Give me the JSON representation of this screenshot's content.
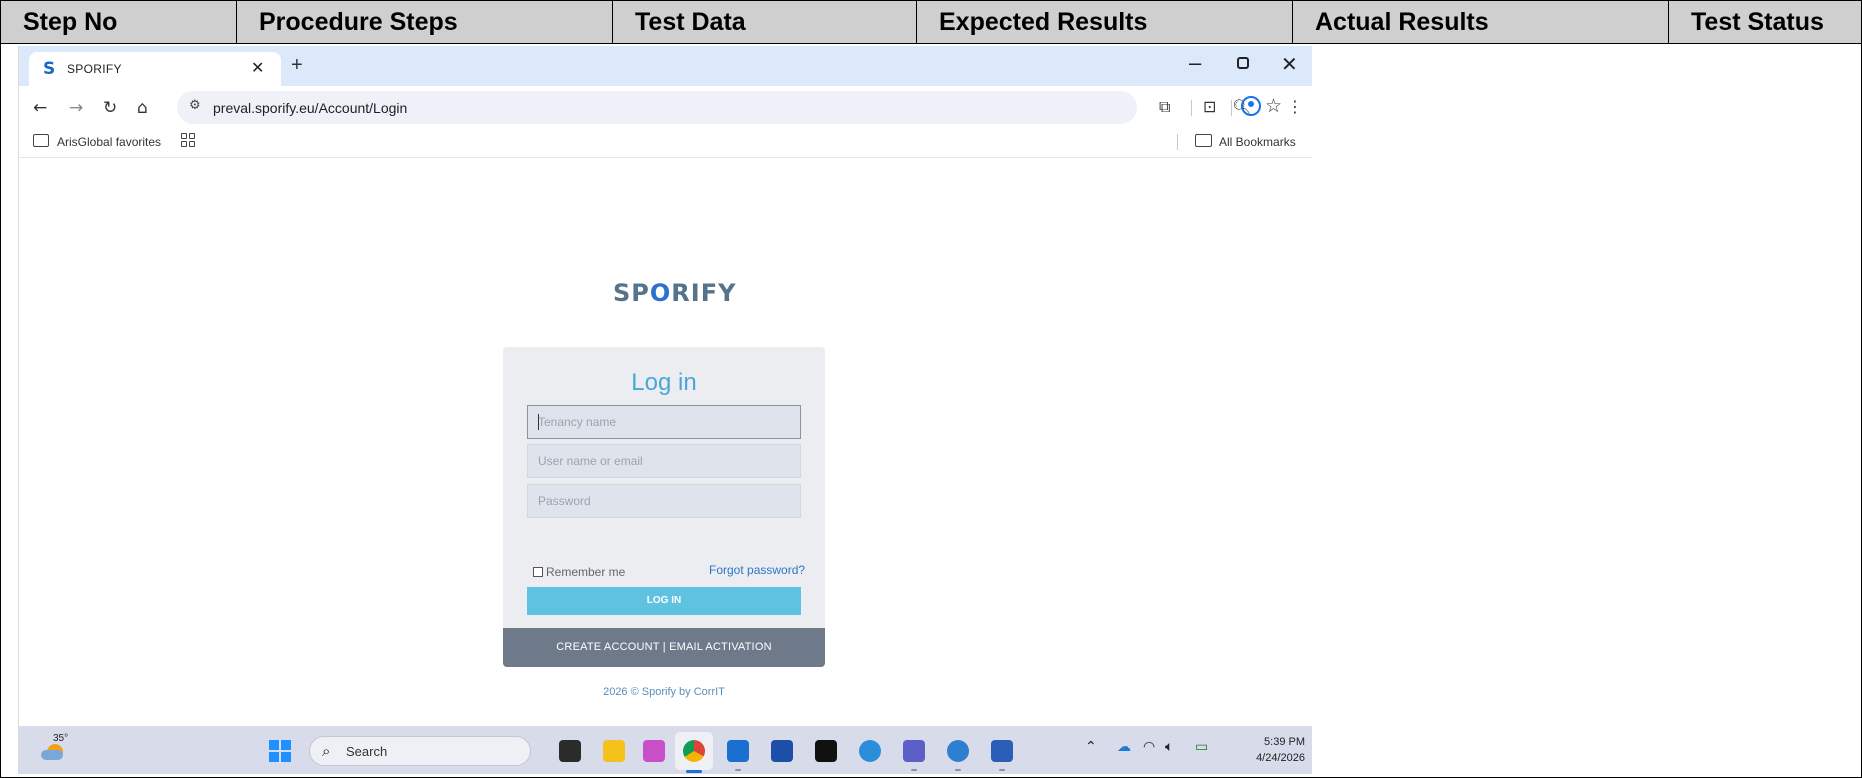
{
  "table": {
    "headers": [
      "Step No",
      "Procedure Steps",
      "Test Data",
      "Expected Results",
      "Actual Results",
      "Test Status"
    ]
  },
  "browser": {
    "tab_title": "SPORIFY",
    "tab_logo": "S",
    "url": "preval.sporify.eu/Account/Login",
    "bookmark_folder": "ArisGlobal favorites",
    "all_bookmarks": "All Bookmarks"
  },
  "login": {
    "brand_start": "SP",
    "brand_o": "O",
    "brand_end": "RIFY",
    "title": "Log in",
    "tenancy_placeholder": "Tenancy name",
    "username_placeholder": "User name or email",
    "password_placeholder": "Password",
    "remember_label": "Remember me",
    "forgot_label": "Forgot password?",
    "login_button": "LOG IN",
    "footer_links": "CREATE ACCOUNT | EMAIL ACTIVATION",
    "copyright_prefix": "2026 © Sporify by ",
    "copyright_link": "CorrIT"
  },
  "taskbar": {
    "temperature": "35°",
    "search_label": "Search",
    "time": "5:39 PM",
    "date": "4/24/2026"
  },
  "icons": [
    "tab-logo-icon",
    "close-icon",
    "plus-icon",
    "minimize-icon",
    "restore-icon",
    "back-icon",
    "forward-icon",
    "reload-icon",
    "home-icon",
    "site-info-icon",
    "zoom-icon",
    "star-icon",
    "extensions-icon",
    "tab-search-icon",
    "profile-icon",
    "menu-icon",
    "folder-icon",
    "apps-icon",
    "weather-icon",
    "windows-start-icon",
    "search-icon",
    "wifi-icon",
    "volume-icon",
    "battery-icon",
    "onedrive-icon",
    "chevron-up-icon"
  ]
}
